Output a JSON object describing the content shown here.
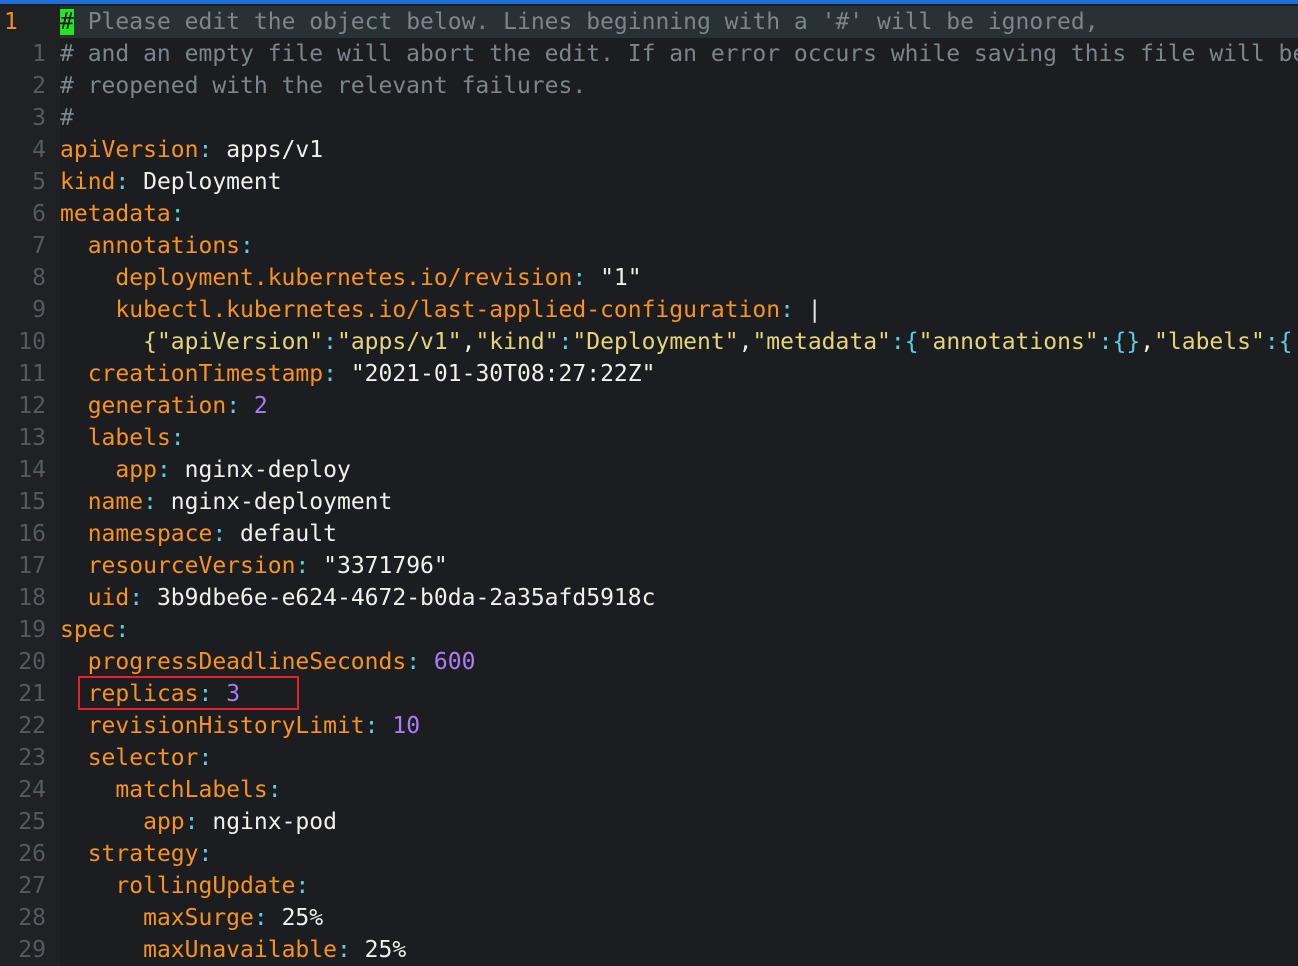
{
  "editor": {
    "cursor_line_number": "1",
    "highlight_color": "#e3222a",
    "lines": [
      {
        "num": "",
        "tokens": [
          {
            "c": "cur-block",
            "t": "#"
          },
          {
            "c": "cm",
            "t": " Please edit the object below. Lines beginning with a '#' will be ignored,"
          }
        ]
      },
      {
        "num": "1",
        "tokens": [
          {
            "c": "cm",
            "t": "# and an empty file will abort the edit. If an error occurs while saving this file will be"
          }
        ]
      },
      {
        "num": "2",
        "tokens": [
          {
            "c": "cm",
            "t": "# reopened with the relevant failures."
          }
        ]
      },
      {
        "num": "3",
        "tokens": [
          {
            "c": "cm",
            "t": "#"
          }
        ]
      },
      {
        "num": "4",
        "tokens": [
          {
            "c": "k",
            "t": "apiVersion"
          },
          {
            "c": "p",
            "t": ":"
          },
          {
            "c": "v",
            "t": " apps/v1"
          }
        ]
      },
      {
        "num": "5",
        "tokens": [
          {
            "c": "k",
            "t": "kind"
          },
          {
            "c": "p",
            "t": ":"
          },
          {
            "c": "v",
            "t": " Deployment"
          }
        ]
      },
      {
        "num": "6",
        "tokens": [
          {
            "c": "k",
            "t": "metadata"
          },
          {
            "c": "p",
            "t": ":"
          }
        ]
      },
      {
        "num": "7",
        "tokens": [
          {
            "c": "v",
            "t": "  "
          },
          {
            "c": "k",
            "t": "annotations"
          },
          {
            "c": "p",
            "t": ":"
          }
        ]
      },
      {
        "num": "8",
        "tokens": [
          {
            "c": "v",
            "t": "    "
          },
          {
            "c": "k",
            "t": "deployment.kubernetes.io/revision"
          },
          {
            "c": "p",
            "t": ":"
          },
          {
            "c": "v",
            "t": " \"1\""
          }
        ]
      },
      {
        "num": "9",
        "tokens": [
          {
            "c": "v",
            "t": "    "
          },
          {
            "c": "k",
            "t": "kubectl.kubernetes.io/last-applied-configuration"
          },
          {
            "c": "p",
            "t": ":"
          },
          {
            "c": "caret",
            "t": " |"
          }
        ]
      },
      {
        "num": "10",
        "tokens": [
          {
            "c": "v",
            "t": "      "
          },
          {
            "c": "s",
            "t": "{\"apiVersion\""
          },
          {
            "c": "p",
            "t": ":"
          },
          {
            "c": "s",
            "t": "\"apps/v1\""
          },
          {
            "c": "v",
            "t": ","
          },
          {
            "c": "s",
            "t": "\"kind\""
          },
          {
            "c": "p",
            "t": ":"
          },
          {
            "c": "s",
            "t": "\"Deployment\""
          },
          {
            "c": "v",
            "t": ","
          },
          {
            "c": "s",
            "t": "\"metadata\""
          },
          {
            "c": "p",
            "t": ":{"
          },
          {
            "c": "s",
            "t": "\"annotations\""
          },
          {
            "c": "p",
            "t": ":{}"
          },
          {
            "c": "v",
            "t": ","
          },
          {
            "c": "s",
            "t": "\"labels\""
          },
          {
            "c": "p",
            "t": ":{"
          }
        ]
      },
      {
        "num": "11",
        "tokens": [
          {
            "c": "v",
            "t": "  "
          },
          {
            "c": "k",
            "t": "creationTimestamp"
          },
          {
            "c": "p",
            "t": ":"
          },
          {
            "c": "v",
            "t": " \"2021-01-30T08:27:22Z\""
          }
        ]
      },
      {
        "num": "12",
        "tokens": [
          {
            "c": "v",
            "t": "  "
          },
          {
            "c": "k",
            "t": "generation"
          },
          {
            "c": "p",
            "t": ":"
          },
          {
            "c": "n",
            "t": " 2"
          }
        ]
      },
      {
        "num": "13",
        "tokens": [
          {
            "c": "v",
            "t": "  "
          },
          {
            "c": "k",
            "t": "labels"
          },
          {
            "c": "p",
            "t": ":"
          }
        ]
      },
      {
        "num": "14",
        "tokens": [
          {
            "c": "v",
            "t": "    "
          },
          {
            "c": "k",
            "t": "app"
          },
          {
            "c": "p",
            "t": ":"
          },
          {
            "c": "v",
            "t": " nginx-deploy"
          }
        ]
      },
      {
        "num": "15",
        "tokens": [
          {
            "c": "v",
            "t": "  "
          },
          {
            "c": "k",
            "t": "name"
          },
          {
            "c": "p",
            "t": ":"
          },
          {
            "c": "v",
            "t": " nginx-deployment"
          }
        ]
      },
      {
        "num": "16",
        "tokens": [
          {
            "c": "v",
            "t": "  "
          },
          {
            "c": "k",
            "t": "namespace"
          },
          {
            "c": "p",
            "t": ":"
          },
          {
            "c": "v",
            "t": " default"
          }
        ]
      },
      {
        "num": "17",
        "tokens": [
          {
            "c": "v",
            "t": "  "
          },
          {
            "c": "k",
            "t": "resourceVersion"
          },
          {
            "c": "p",
            "t": ":"
          },
          {
            "c": "v",
            "t": " \"3371796\""
          }
        ]
      },
      {
        "num": "18",
        "tokens": [
          {
            "c": "v",
            "t": "  "
          },
          {
            "c": "k",
            "t": "uid"
          },
          {
            "c": "p",
            "t": ":"
          },
          {
            "c": "v",
            "t": " 3b9dbe6e-e624-4672-b0da-2a35afd5918c"
          }
        ]
      },
      {
        "num": "19",
        "tokens": [
          {
            "c": "k",
            "t": "spec"
          },
          {
            "c": "p",
            "t": ":"
          }
        ]
      },
      {
        "num": "20",
        "tokens": [
          {
            "c": "v",
            "t": "  "
          },
          {
            "c": "k",
            "t": "progressDeadlineSeconds"
          },
          {
            "c": "p",
            "t": ":"
          },
          {
            "c": "n",
            "t": " 600"
          }
        ]
      },
      {
        "num": "21",
        "tokens": [
          {
            "c": "v",
            "t": "  "
          },
          {
            "c": "k",
            "t": "replicas"
          },
          {
            "c": "p",
            "t": ":"
          },
          {
            "c": "n",
            "t": " 3"
          }
        ]
      },
      {
        "num": "22",
        "tokens": [
          {
            "c": "v",
            "t": "  "
          },
          {
            "c": "k",
            "t": "revisionHistoryLimit"
          },
          {
            "c": "p",
            "t": ":"
          },
          {
            "c": "n",
            "t": " 10"
          }
        ]
      },
      {
        "num": "23",
        "tokens": [
          {
            "c": "v",
            "t": "  "
          },
          {
            "c": "k",
            "t": "selector"
          },
          {
            "c": "p",
            "t": ":"
          }
        ]
      },
      {
        "num": "24",
        "tokens": [
          {
            "c": "v",
            "t": "    "
          },
          {
            "c": "k",
            "t": "matchLabels"
          },
          {
            "c": "p",
            "t": ":"
          }
        ]
      },
      {
        "num": "25",
        "tokens": [
          {
            "c": "v",
            "t": "      "
          },
          {
            "c": "k",
            "t": "app"
          },
          {
            "c": "p",
            "t": ":"
          },
          {
            "c": "v",
            "t": " nginx-pod"
          }
        ]
      },
      {
        "num": "26",
        "tokens": [
          {
            "c": "v",
            "t": "  "
          },
          {
            "c": "k",
            "t": "strategy"
          },
          {
            "c": "p",
            "t": ":"
          }
        ]
      },
      {
        "num": "27",
        "tokens": [
          {
            "c": "v",
            "t": "    "
          },
          {
            "c": "k",
            "t": "rollingUpdate"
          },
          {
            "c": "p",
            "t": ":"
          }
        ]
      },
      {
        "num": "28",
        "tokens": [
          {
            "c": "v",
            "t": "      "
          },
          {
            "c": "k",
            "t": "maxSurge"
          },
          {
            "c": "p",
            "t": ":"
          },
          {
            "c": "v",
            "t": " 25%"
          }
        ]
      },
      {
        "num": "29",
        "tokens": [
          {
            "c": "v",
            "t": "      "
          },
          {
            "c": "k",
            "t": "maxUnavailable"
          },
          {
            "c": "p",
            "t": ":"
          },
          {
            "c": "v",
            "t": " 25%"
          }
        ]
      }
    ]
  }
}
